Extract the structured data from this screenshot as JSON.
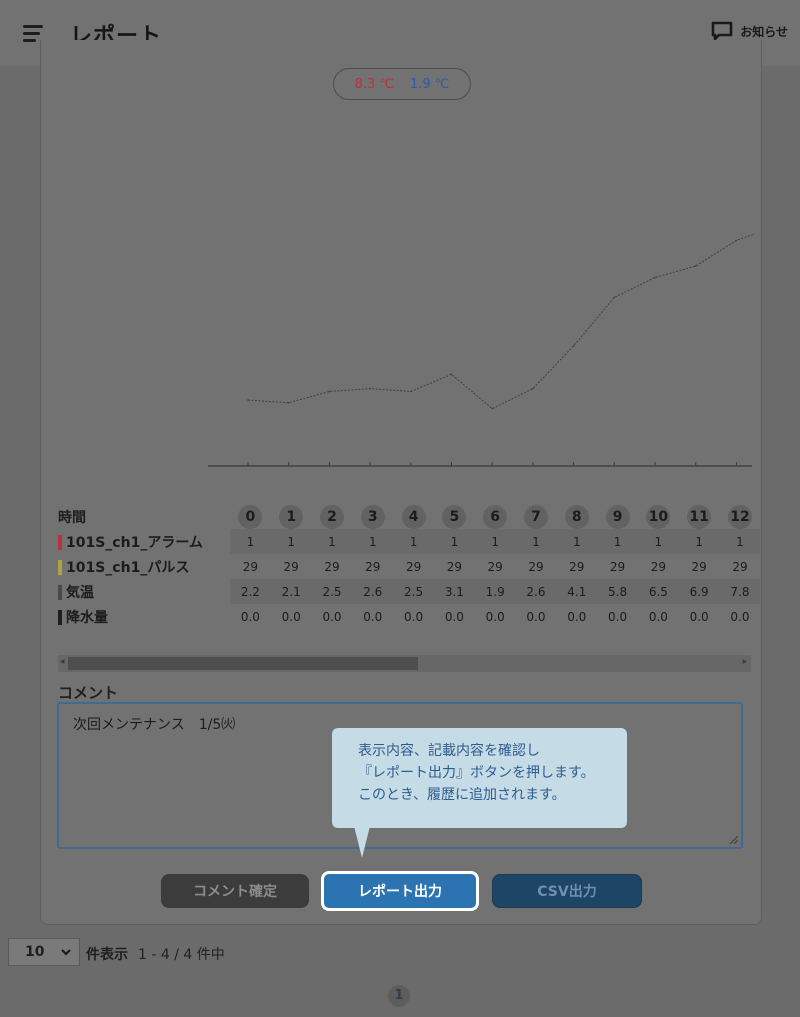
{
  "header": {
    "title": "レポート",
    "notice_label": "お知らせ"
  },
  "legend": {
    "value_red": "8.3 ℃",
    "value_blue": "1.9 ℃"
  },
  "chart_data": {
    "type": "line",
    "x": [
      0,
      1,
      2,
      3,
      4,
      5,
      6,
      7,
      8,
      9,
      10,
      11,
      12,
      13
    ],
    "series": [
      {
        "values": [
          2.2,
          2.1,
          2.5,
          2.6,
          2.5,
          3.1,
          1.9,
          2.6,
          4.1,
          5.8,
          6.5,
          6.9,
          7.8,
          8.3
        ]
      }
    ],
    "xlabel": "",
    "ylabel": "",
    "grid": false
  },
  "table": {
    "header_label": "時間",
    "hours": [
      "0",
      "1",
      "2",
      "3",
      "4",
      "5",
      "6",
      "7",
      "8",
      "9",
      "10",
      "11",
      "12"
    ],
    "rows": [
      {
        "label": "101S_ch1_アラーム",
        "marker": "#b8323c",
        "values": [
          "1",
          "1",
          "1",
          "1",
          "1",
          "1",
          "1",
          "1",
          "1",
          "1",
          "1",
          "1",
          "1"
        ]
      },
      {
        "label": "101S_ch1_パルス",
        "marker": "#b0a240",
        "values": [
          "29",
          "29",
          "29",
          "29",
          "29",
          "29",
          "29",
          "29",
          "29",
          "29",
          "29",
          "29",
          "29"
        ]
      },
      {
        "label": "気温",
        "marker": "#4a4a4a",
        "values": [
          "2.2",
          "2.1",
          "2.5",
          "2.6",
          "2.5",
          "3.1",
          "1.9",
          "2.6",
          "4.1",
          "5.8",
          "6.5",
          "6.9",
          "7.8"
        ]
      },
      {
        "label": "降水量",
        "marker": "#1e1e1e",
        "values": [
          "0.0",
          "0.0",
          "0.0",
          "0.0",
          "0.0",
          "0.0",
          "0.0",
          "0.0",
          "0.0",
          "0.0",
          "0.0",
          "0.0",
          "0.0"
        ]
      }
    ]
  },
  "comment": {
    "label": "コメント",
    "value": "次回メンテナンス　1/5㈫"
  },
  "tooltip": {
    "line1": "表示内容、記載内容を確認し",
    "line2": "『レポート出力』ボタンを押します。",
    "line3": "このとき、履歴に追加されます。"
  },
  "buttons": {
    "comment_confirm": "コメント確定",
    "report_output": "レポート出力",
    "csv_output": "CSV出力"
  },
  "pagination": {
    "per_page": "10",
    "per_page_label": "件表示",
    "range": "1 - 4 / 4 件中",
    "current_page": "1"
  }
}
